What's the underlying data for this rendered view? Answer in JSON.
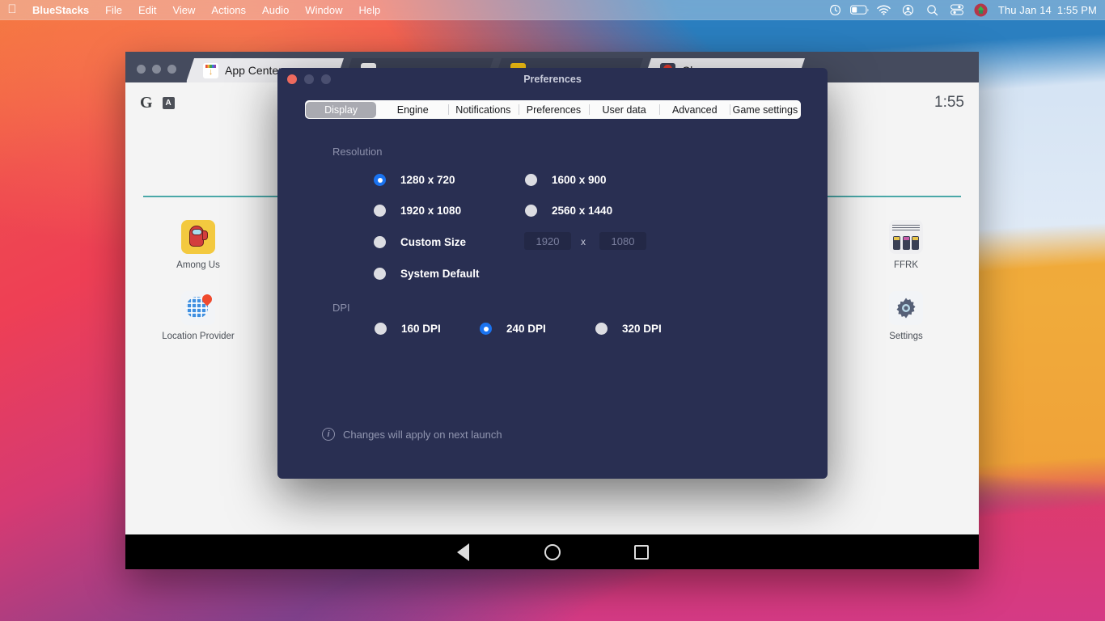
{
  "menubar": {
    "apple_icon": "apple-logo",
    "items": [
      {
        "label": "BlueStacks",
        "bold": true
      },
      {
        "label": "File",
        "bold": false
      },
      {
        "label": "Edit",
        "bold": false
      },
      {
        "label": "View",
        "bold": false
      },
      {
        "label": "Actions",
        "bold": false
      },
      {
        "label": "Audio",
        "bold": false
      },
      {
        "label": "Window",
        "bold": false
      },
      {
        "label": "Help",
        "bold": false
      }
    ],
    "status_icons": [
      "time-machine-icon",
      "battery-icon",
      "wifi-icon",
      "user-account-icon",
      "spotlight-search-icon",
      "control-center-icon",
      "bluestacks-menu-icon"
    ],
    "clock_day": "Thu Jan 14",
    "clock_time": "1:55 PM"
  },
  "bluestacks_window": {
    "tabs": [
      {
        "label": "App Center",
        "icon": "app-center-icon",
        "closable": false
      },
      {
        "label": "",
        "icon": "ffrk-tab-icon",
        "closable": false
      },
      {
        "label": "",
        "icon": "among-us-tab-icon",
        "closable": false
      },
      {
        "label": "Chrome",
        "icon": "chrome-tab-icon",
        "closable": true
      }
    ],
    "close_label": "×",
    "android": {
      "status_clock": "1:55",
      "g_icon_label": "G",
      "a_icon_label": "A",
      "apps_left": [
        {
          "label": "Among Us",
          "icon": "among-us-icon"
        },
        {
          "label": "Location Provider",
          "icon": "location-provider-icon"
        }
      ],
      "apps_right": [
        {
          "label": "FFRK",
          "icon": "ffrk-icon"
        },
        {
          "label": "Settings",
          "icon": "settings-gear-icon"
        }
      ],
      "navbar": [
        "back-icon",
        "home-icon",
        "recents-icon"
      ]
    }
  },
  "preferences_dialog": {
    "title": "Preferences",
    "traffic_lights": [
      "close-button",
      "minimize-button-disabled",
      "maximize-button-disabled"
    ],
    "tabs": [
      {
        "label": "Display",
        "active": true
      },
      {
        "label": "Engine",
        "active": false
      },
      {
        "label": "Notifications",
        "active": false
      },
      {
        "label": "Preferences",
        "active": false
      },
      {
        "label": "User data",
        "active": false
      },
      {
        "label": "Advanced",
        "active": false
      },
      {
        "label": "Game settings",
        "active": false
      }
    ],
    "resolution": {
      "title": "Resolution",
      "options": [
        {
          "label": "1280 x 720",
          "selected": true
        },
        {
          "label": "1600 x 900",
          "selected": false
        },
        {
          "label": "1920 x 1080",
          "selected": false
        },
        {
          "label": "2560 x 1440",
          "selected": false
        },
        {
          "label": "Custom Size",
          "selected": false
        },
        {
          "label": "System Default",
          "selected": false
        }
      ],
      "custom_width_placeholder": "1920",
      "custom_height_placeholder": "1080",
      "custom_separator": "x"
    },
    "dpi": {
      "title": "DPI",
      "options": [
        {
          "label": "160 DPI",
          "selected": false
        },
        {
          "label": "240 DPI",
          "selected": true
        },
        {
          "label": "320 DPI",
          "selected": false
        }
      ]
    },
    "note": {
      "icon": "info-icon",
      "text": "Changes will apply on next launch"
    },
    "colors": {
      "dialog_bg": "#292f52",
      "accent_blue": "#1a73f0",
      "radio_off": "#dcdde2",
      "section_title": "#8c90ab",
      "input_bg": "#232846"
    }
  }
}
